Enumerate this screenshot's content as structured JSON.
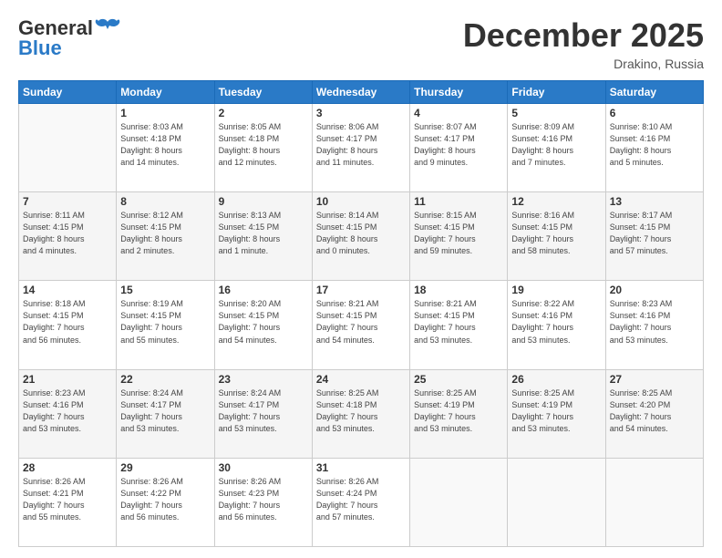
{
  "header": {
    "logo_general": "General",
    "logo_blue": "Blue",
    "month_title": "December 2025",
    "location": "Drakino, Russia"
  },
  "weekdays": [
    "Sunday",
    "Monday",
    "Tuesday",
    "Wednesday",
    "Thursday",
    "Friday",
    "Saturday"
  ],
  "weeks": [
    [
      {
        "day": "",
        "info": ""
      },
      {
        "day": "1",
        "info": "Sunrise: 8:03 AM\nSunset: 4:18 PM\nDaylight: 8 hours\nand 14 minutes."
      },
      {
        "day": "2",
        "info": "Sunrise: 8:05 AM\nSunset: 4:18 PM\nDaylight: 8 hours\nand 12 minutes."
      },
      {
        "day": "3",
        "info": "Sunrise: 8:06 AM\nSunset: 4:17 PM\nDaylight: 8 hours\nand 11 minutes."
      },
      {
        "day": "4",
        "info": "Sunrise: 8:07 AM\nSunset: 4:17 PM\nDaylight: 8 hours\nand 9 minutes."
      },
      {
        "day": "5",
        "info": "Sunrise: 8:09 AM\nSunset: 4:16 PM\nDaylight: 8 hours\nand 7 minutes."
      },
      {
        "day": "6",
        "info": "Sunrise: 8:10 AM\nSunset: 4:16 PM\nDaylight: 8 hours\nand 5 minutes."
      }
    ],
    [
      {
        "day": "7",
        "info": "Sunrise: 8:11 AM\nSunset: 4:15 PM\nDaylight: 8 hours\nand 4 minutes."
      },
      {
        "day": "8",
        "info": "Sunrise: 8:12 AM\nSunset: 4:15 PM\nDaylight: 8 hours\nand 2 minutes."
      },
      {
        "day": "9",
        "info": "Sunrise: 8:13 AM\nSunset: 4:15 PM\nDaylight: 8 hours\nand 1 minute."
      },
      {
        "day": "10",
        "info": "Sunrise: 8:14 AM\nSunset: 4:15 PM\nDaylight: 8 hours\nand 0 minutes."
      },
      {
        "day": "11",
        "info": "Sunrise: 8:15 AM\nSunset: 4:15 PM\nDaylight: 7 hours\nand 59 minutes."
      },
      {
        "day": "12",
        "info": "Sunrise: 8:16 AM\nSunset: 4:15 PM\nDaylight: 7 hours\nand 58 minutes."
      },
      {
        "day": "13",
        "info": "Sunrise: 8:17 AM\nSunset: 4:15 PM\nDaylight: 7 hours\nand 57 minutes."
      }
    ],
    [
      {
        "day": "14",
        "info": "Sunrise: 8:18 AM\nSunset: 4:15 PM\nDaylight: 7 hours\nand 56 minutes."
      },
      {
        "day": "15",
        "info": "Sunrise: 8:19 AM\nSunset: 4:15 PM\nDaylight: 7 hours\nand 55 minutes."
      },
      {
        "day": "16",
        "info": "Sunrise: 8:20 AM\nSunset: 4:15 PM\nDaylight: 7 hours\nand 54 minutes."
      },
      {
        "day": "17",
        "info": "Sunrise: 8:21 AM\nSunset: 4:15 PM\nDaylight: 7 hours\nand 54 minutes."
      },
      {
        "day": "18",
        "info": "Sunrise: 8:21 AM\nSunset: 4:15 PM\nDaylight: 7 hours\nand 53 minutes."
      },
      {
        "day": "19",
        "info": "Sunrise: 8:22 AM\nSunset: 4:16 PM\nDaylight: 7 hours\nand 53 minutes."
      },
      {
        "day": "20",
        "info": "Sunrise: 8:23 AM\nSunset: 4:16 PM\nDaylight: 7 hours\nand 53 minutes."
      }
    ],
    [
      {
        "day": "21",
        "info": "Sunrise: 8:23 AM\nSunset: 4:16 PM\nDaylight: 7 hours\nand 53 minutes."
      },
      {
        "day": "22",
        "info": "Sunrise: 8:24 AM\nSunset: 4:17 PM\nDaylight: 7 hours\nand 53 minutes."
      },
      {
        "day": "23",
        "info": "Sunrise: 8:24 AM\nSunset: 4:17 PM\nDaylight: 7 hours\nand 53 minutes."
      },
      {
        "day": "24",
        "info": "Sunrise: 8:25 AM\nSunset: 4:18 PM\nDaylight: 7 hours\nand 53 minutes."
      },
      {
        "day": "25",
        "info": "Sunrise: 8:25 AM\nSunset: 4:19 PM\nDaylight: 7 hours\nand 53 minutes."
      },
      {
        "day": "26",
        "info": "Sunrise: 8:25 AM\nSunset: 4:19 PM\nDaylight: 7 hours\nand 53 minutes."
      },
      {
        "day": "27",
        "info": "Sunrise: 8:25 AM\nSunset: 4:20 PM\nDaylight: 7 hours\nand 54 minutes."
      }
    ],
    [
      {
        "day": "28",
        "info": "Sunrise: 8:26 AM\nSunset: 4:21 PM\nDaylight: 7 hours\nand 55 minutes."
      },
      {
        "day": "29",
        "info": "Sunrise: 8:26 AM\nSunset: 4:22 PM\nDaylight: 7 hours\nand 56 minutes."
      },
      {
        "day": "30",
        "info": "Sunrise: 8:26 AM\nSunset: 4:23 PM\nDaylight: 7 hours\nand 56 minutes."
      },
      {
        "day": "31",
        "info": "Sunrise: 8:26 AM\nSunset: 4:24 PM\nDaylight: 7 hours\nand 57 minutes."
      },
      {
        "day": "",
        "info": ""
      },
      {
        "day": "",
        "info": ""
      },
      {
        "day": "",
        "info": ""
      }
    ]
  ]
}
